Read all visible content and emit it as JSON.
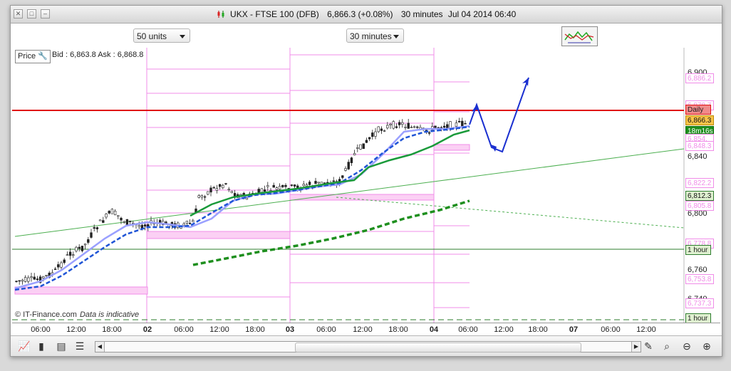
{
  "window": {
    "title": "UKX - FTSE 100 (DFB)",
    "price": "6,866.3 (+0.08%)",
    "interval": "30 minutes",
    "datetime": "Jul 04 2014 06:40"
  },
  "toolbar": {
    "units_select": "50 units",
    "interval_select": "30 minutes",
    "study_icon": "trend-study-icon"
  },
  "chart": {
    "series_label": "Price",
    "bid_ask": "Bid : 6,863.8 Ask : 6,868.8",
    "copyright": "© IT-Finance.com",
    "disclaimer": "Data is indicative"
  },
  "chart_data": {
    "type": "line",
    "y_ticks": [
      "6,900",
      "6,840",
      "6,800",
      "6,760",
      "6,740"
    ],
    "x_ticks": [
      "06:00",
      "12:00",
      "18:00",
      "02",
      "06:00",
      "12:00",
      "18:00",
      "03",
      "06:00",
      "12:00",
      "18:00",
      "04",
      "06:00",
      "12:00",
      "18:00",
      "07",
      "06:00",
      "12:00"
    ],
    "price_boxes": [
      "6,886.2",
      "6,878.7",
      "6,866.3",
      "18m16s",
      "6,854.",
      "6,848.3",
      "6,822.2",
      "6,812.3",
      "6,805.8",
      "6,778.8",
      "6,753.8",
      "6,737.3"
    ],
    "line_labels": [
      "Daily",
      "1 hour",
      "1 hour"
    ],
    "current_price": 6866.3,
    "countdown": "18m16s",
    "colors": {
      "daily": "#e01010",
      "hourly": "#2e7d2e",
      "current": "#f0b000",
      "pivot": "#f080e0",
      "forecast": "#1a2fd0"
    }
  },
  "bottombar": {
    "icons": [
      "chart-type-icon",
      "candlestick-icon",
      "print-icon",
      "studies-icon",
      "pencil-icon",
      "zoom-fit-icon",
      "zoom-out-icon",
      "zoom-in-icon"
    ]
  }
}
